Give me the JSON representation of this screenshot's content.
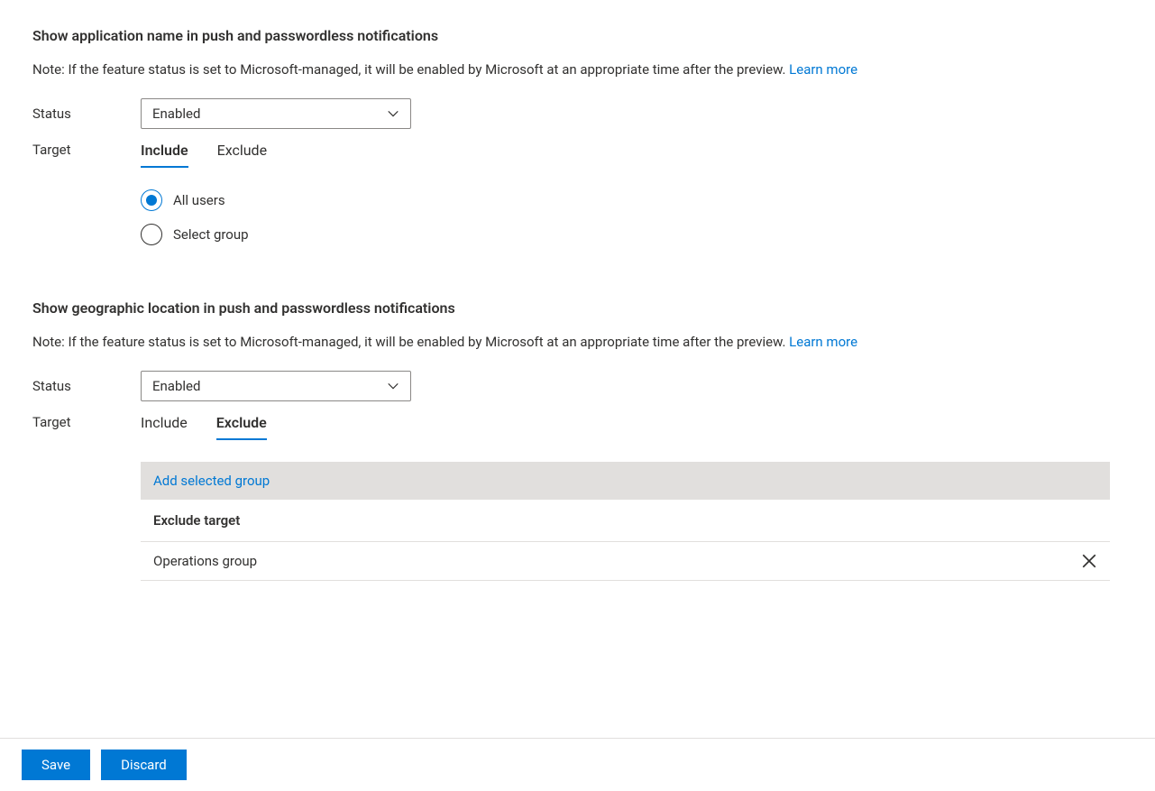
{
  "section1": {
    "title": "Show application name in push and passwordless notifications",
    "note": "Note: If the feature status is set to Microsoft-managed, it will be enabled by Microsoft at an appropriate time after the preview. ",
    "learn_more": "Learn more",
    "status_label": "Status",
    "status_value": "Enabled",
    "target_label": "Target",
    "tabs": {
      "include": "Include",
      "exclude": "Exclude"
    },
    "radio": {
      "all_users": "All users",
      "select_group": "Select group"
    }
  },
  "section2": {
    "title": "Show geographic location in push and passwordless notifications",
    "note": "Note: If the feature status is set to Microsoft-managed, it will be enabled by Microsoft at an appropriate time after the preview. ",
    "learn_more": "Learn more",
    "status_label": "Status",
    "status_value": "Enabled",
    "target_label": "Target",
    "tabs": {
      "include": "Include",
      "exclude": "Exclude"
    },
    "add_group": "Add selected group",
    "exclude_header": "Exclude target",
    "exclude_rows": [
      {
        "name": "Operations group"
      }
    ]
  },
  "footer": {
    "save": "Save",
    "discard": "Discard"
  }
}
